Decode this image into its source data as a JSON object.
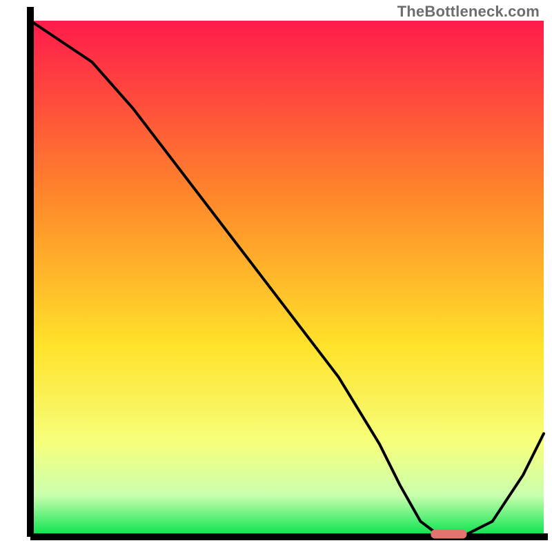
{
  "watermark": "TheBottleneck.com",
  "colors": {
    "axis": "#000000",
    "curve": "#000000",
    "marker_fill": "#e2736f",
    "grad_top": "#ff1b4b",
    "grad_mid_upper": "#ff8a2a",
    "grad_mid": "#ffe22a",
    "grad_mid_lower": "#f6ff7d",
    "grad_low": "#c9ffae",
    "grad_bottom": "#00e24a"
  },
  "chart_data": {
    "type": "line",
    "title": "",
    "xlabel": "",
    "ylabel": "",
    "xlim": [
      0,
      100
    ],
    "ylim": [
      0,
      100
    ],
    "x": [
      0,
      12,
      20,
      30,
      40,
      50,
      60,
      68,
      72,
      76,
      80,
      84,
      90,
      96,
      100
    ],
    "values": [
      100,
      92,
      83,
      70,
      57,
      44,
      31,
      18,
      10,
      3,
      0,
      0,
      3,
      12,
      20
    ],
    "optimum_marker": {
      "x_start": 78,
      "x_end": 85,
      "y": 0
    },
    "gradient_stops": [
      {
        "pct": 0,
        "color": "#ff1b4b"
      },
      {
        "pct": 35,
        "color": "#ff8a2a"
      },
      {
        "pct": 63,
        "color": "#ffe22a"
      },
      {
        "pct": 82,
        "color": "#f6ff7d"
      },
      {
        "pct": 92,
        "color": "#c9ffae"
      },
      {
        "pct": 100,
        "color": "#00e24a"
      }
    ]
  }
}
